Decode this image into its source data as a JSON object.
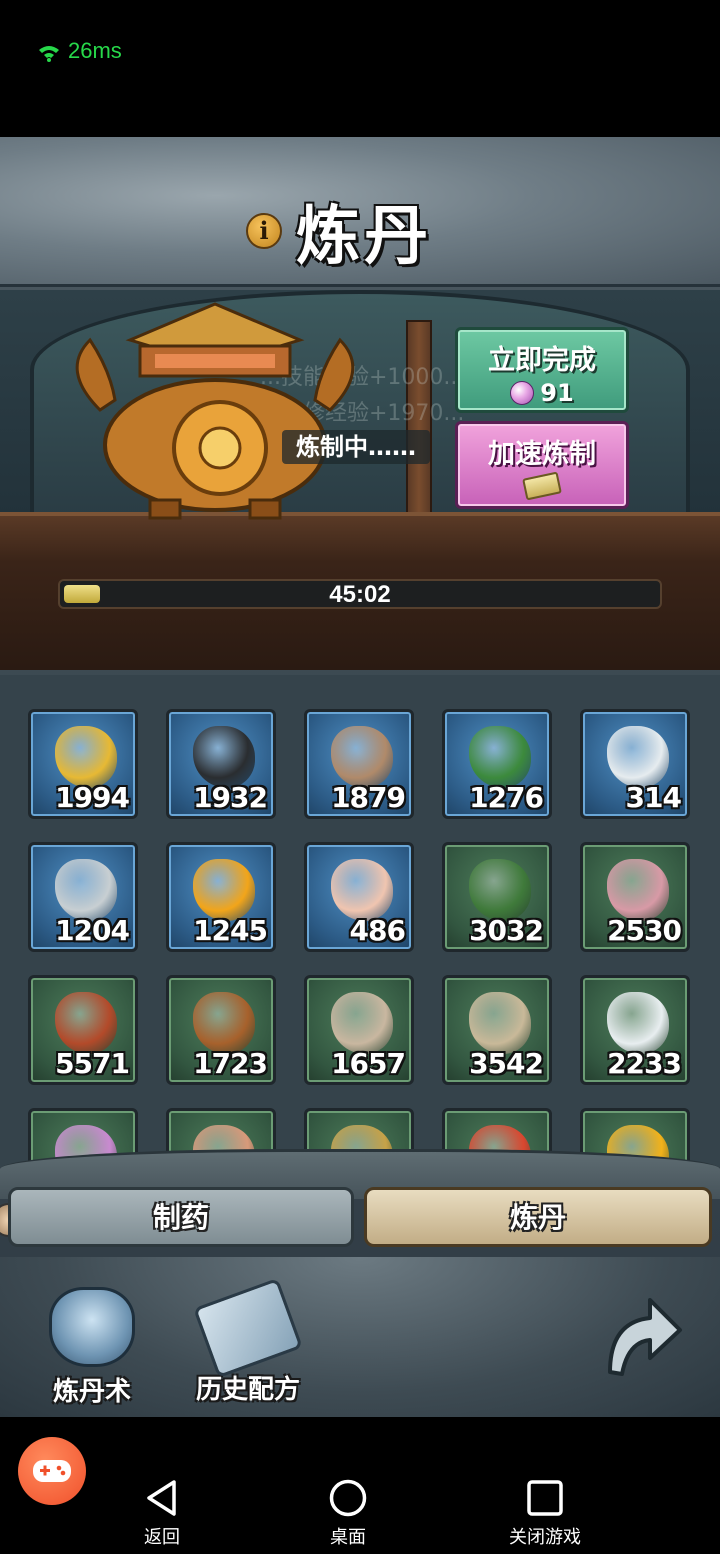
{
  "status": {
    "ping": "26ms",
    "color": "#27d84a"
  },
  "header": {
    "title": "炼丹"
  },
  "furnace": {
    "status_text": "炼制中……",
    "ghost_lines": [
      "...技能经验+1000...",
      "...体修经验+1970..."
    ],
    "complete_now": {
      "label": "立即完成",
      "cost": "91"
    },
    "speed_up": {
      "label": "加速炼制"
    },
    "progress": {
      "time_left": "45:02",
      "fraction": 0.06
    }
  },
  "inventory": {
    "items": [
      {
        "name": "golden-bird-icon",
        "qty": "1994",
        "tier": "blue",
        "color": "#e7b934"
      },
      {
        "name": "rope-coil-icon",
        "qty": "1932",
        "tier": "blue",
        "color": "#2a2d30"
      },
      {
        "name": "hide-icon",
        "qty": "1879",
        "tier": "blue",
        "color": "#b08a6a"
      },
      {
        "name": "leaf-icon",
        "qty": "1276",
        "tier": "blue",
        "color": "#3c8a3c"
      },
      {
        "name": "feather-icon",
        "qty": "314",
        "tier": "blue",
        "color": "#e6ecef"
      },
      {
        "name": "bone-icon",
        "qty": "1204",
        "tier": "blue",
        "color": "#c8cfd2"
      },
      {
        "name": "amber-icon",
        "qty": "1245",
        "tier": "blue",
        "color": "#f2a51a"
      },
      {
        "name": "shell-icon",
        "qty": "486",
        "tier": "blue",
        "color": "#f0c5b0"
      },
      {
        "name": "grass-icon",
        "qty": "3032",
        "tier": "green",
        "color": "#3f7a3a"
      },
      {
        "name": "mushroom-icon",
        "qty": "2530",
        "tier": "green",
        "color": "#d89aa6"
      },
      {
        "name": "ginseng-icon",
        "qty": "5571",
        "tier": "green",
        "color": "#b34a2a"
      },
      {
        "name": "lingzhi-icon",
        "qty": "1723",
        "tier": "green",
        "color": "#a7612c"
      },
      {
        "name": "rock-icon",
        "qty": "1657",
        "tier": "green",
        "color": "#c9b7a0"
      },
      {
        "name": "branch-icon",
        "qty": "3542",
        "tier": "green",
        "color": "#c9b999"
      },
      {
        "name": "white-flower-icon",
        "qty": "2233",
        "tier": "green",
        "color": "#e8eef0"
      },
      {
        "name": "purple-flower-icon",
        "qty": "",
        "tier": "green",
        "color": "#c98ad0"
      },
      {
        "name": "sprout-icon",
        "qty": "",
        "tier": "green",
        "color": "#d89a7a"
      },
      {
        "name": "vine-icon",
        "qty": "",
        "tier": "green",
        "color": "#c7a248"
      },
      {
        "name": "red-flower-icon",
        "qty": "",
        "tier": "green",
        "color": "#d9472f"
      },
      {
        "name": "yellow-flower-icon",
        "qty": "",
        "tier": "green",
        "color": "#f2b21a"
      }
    ]
  },
  "tabs": {
    "zhiyao": "制药",
    "liandan": "炼丹"
  },
  "bottom_menu": {
    "alchemy_skill": "炼丹术",
    "history_recipes": "历史配方"
  },
  "navbar": {
    "back": "返回",
    "desktop": "桌面",
    "close_game": "关闭游戏"
  }
}
